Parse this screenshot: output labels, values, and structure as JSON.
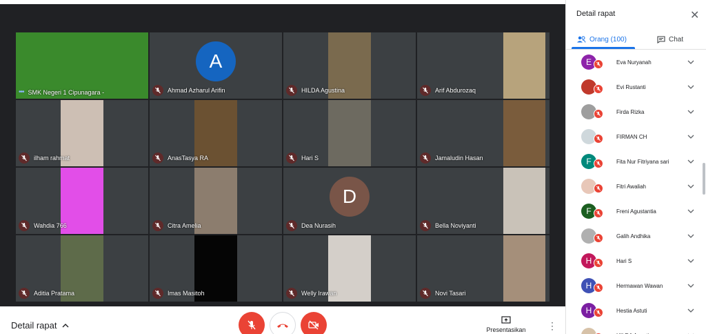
{
  "tiles": [
    {
      "name": "SMK Negeri 1 Cipunagara -",
      "kind": "video-full",
      "bg": "#3a8a2c",
      "speaking": true
    },
    {
      "name": "Ahmad Azharul Arifin",
      "kind": "avatar",
      "initial": "A",
      "color": "#1565c0"
    },
    {
      "name": "HILDA Agustina",
      "kind": "video",
      "bg": "#7a6a4e"
    },
    {
      "name": "Arif Abdurozaq",
      "kind": "video-right",
      "bg": "#b7a37c"
    },
    {
      "name": "ilham rahmat",
      "kind": "video",
      "bg": "#cdbfb4"
    },
    {
      "name": "AnasTasya RA",
      "kind": "video",
      "bg": "#6b5132"
    },
    {
      "name": "Hari S",
      "kind": "video",
      "bg": "#6d6a60"
    },
    {
      "name": "Jamaludin Hasan",
      "kind": "video-right",
      "bg": "#7a5c3c"
    },
    {
      "name": "Wahdia 766",
      "kind": "video",
      "bg": "#e24ee8"
    },
    {
      "name": "Citra Amelia",
      "kind": "video",
      "bg": "#8c7d6e"
    },
    {
      "name": "Dea Nurasih",
      "kind": "avatar",
      "initial": "D",
      "color": "#795548"
    },
    {
      "name": "Bella Noviyanti",
      "kind": "video-right",
      "bg": "#c9c2b8"
    },
    {
      "name": "Aditia Pratama",
      "kind": "video",
      "bg": "#5e6b4a"
    },
    {
      "name": "Imas Masitoh",
      "kind": "video",
      "bg": "#050505"
    },
    {
      "name": "Welly Irawan",
      "kind": "video",
      "bg": "#d4cfc9"
    },
    {
      "name": "Novi Tasari",
      "kind": "video-right",
      "bg": "#a58f7a"
    }
  ],
  "bottombar": {
    "details_label": "Detail rapat",
    "present_label": "Presentasikan sekarang",
    "colors": {
      "end_call": "#ea4335",
      "mute": "#ea4335"
    }
  },
  "panel": {
    "title": "Detail rapat",
    "people_tab": "Orang (100)",
    "chat_tab": "Chat",
    "accent": "#1a73e8",
    "participants": [
      {
        "name": "Eva Nuryanah",
        "initial": "E",
        "color": "#8e24aa"
      },
      {
        "name": "Evi Rustanti",
        "initial": "",
        "color": "#c0392b"
      },
      {
        "name": "Firda Rizka",
        "initial": "",
        "color": "#9e9e9e"
      },
      {
        "name": "FIRMAN CH",
        "initial": "",
        "color": "#cfd8dc"
      },
      {
        "name": "Fita Nur Fitriyana sari",
        "initial": "F",
        "color": "#00897b"
      },
      {
        "name": "Fitri Awaliah",
        "initial": "",
        "color": "#e8c7b8"
      },
      {
        "name": "Freni Agustantia",
        "initial": "F",
        "color": "#1b5e20"
      },
      {
        "name": "Galih Andhika",
        "initial": "",
        "color": "#b0b0b0"
      },
      {
        "name": "Hari S",
        "initial": "H",
        "color": "#c2185b"
      },
      {
        "name": "Hermawan Wawan",
        "initial": "H",
        "color": "#3f51b5"
      },
      {
        "name": "Hestia Astuti",
        "initial": "H",
        "color": "#7b1fa2"
      },
      {
        "name": "HILDA Agustina",
        "initial": "",
        "color": "#d7c2a8"
      }
    ]
  }
}
